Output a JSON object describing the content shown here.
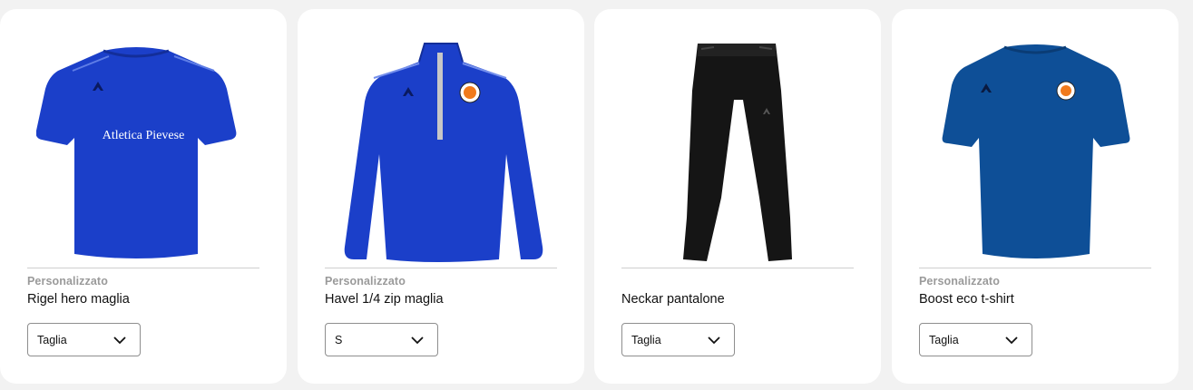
{
  "products": [
    {
      "tag": "Personalizzato",
      "name": "Rigel hero maglia",
      "size": "Taglia",
      "print_text": "Atletica Pievese",
      "icon": "royal-blue-tshirt"
    },
    {
      "tag": "Personalizzato",
      "name": "Havel 1/4 zip maglia",
      "size": "S",
      "icon": "royal-blue-quarter-zip"
    },
    {
      "tag": "",
      "name": "Neckar pantalone",
      "size": "Taglia",
      "icon": "black-pants"
    },
    {
      "tag": "Personalizzato",
      "name": "Boost eco t-shirt",
      "size": "Taglia",
      "icon": "navy-blue-tshirt"
    }
  ],
  "colors": {
    "royal": "#1b3fc9",
    "navy": "#0e4f97",
    "black": "#151515",
    "logo": "#f07a1c"
  }
}
